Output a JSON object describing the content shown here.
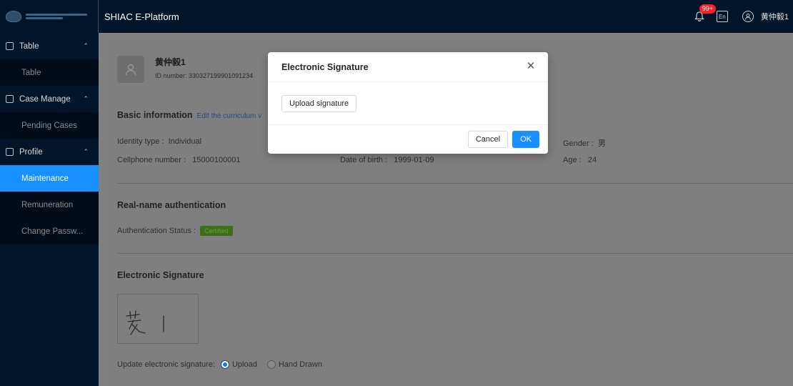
{
  "header": {
    "brand": "SHIAC E-Platform",
    "notification_badge": "99+",
    "lang_label": "En",
    "user_name": "黄仲毅1"
  },
  "sidebar": {
    "groups": [
      {
        "label": "Table",
        "items": [
          {
            "label": "Table"
          }
        ]
      },
      {
        "label": "Case Manage",
        "items": [
          {
            "label": "Pending Cases"
          }
        ]
      },
      {
        "label": "Profile",
        "items": [
          {
            "label": "Maintenance",
            "active": true
          },
          {
            "label": "Remuneration"
          },
          {
            "label": "Change Passw..."
          }
        ]
      }
    ]
  },
  "profile": {
    "name": "黄仲毅1",
    "id_number": "ID number: 330327199901091234"
  },
  "basic_info": {
    "title": "Basic information",
    "edit_link": "Edit the curriculum v",
    "identity_type_label": "Identity type :",
    "identity_type_value": "Individual",
    "gender_label": "Gender :",
    "gender_value": "男",
    "cellphone_label": "Cellphone number :",
    "cellphone_value": "15000100001",
    "dob_label": "Date of birth :",
    "dob_value": "1999-01-09",
    "age_label": "Age :",
    "age_value": "24"
  },
  "auth": {
    "title": "Real-name authentication",
    "status_label": "Authentication Status :",
    "status_value": "Certified"
  },
  "signature": {
    "title": "Electronic Signature",
    "update_label": "Update electronic signature:",
    "option_upload": "Upload",
    "option_hand": "Hand Drawn"
  },
  "modal": {
    "title": "Electronic Signature",
    "upload_button": "Upload signature",
    "cancel": "Cancel",
    "ok": "OK"
  },
  "colors": {
    "sidebar_bg": "#001529",
    "primary": "#1890ff",
    "badge": "#f5222d"
  }
}
